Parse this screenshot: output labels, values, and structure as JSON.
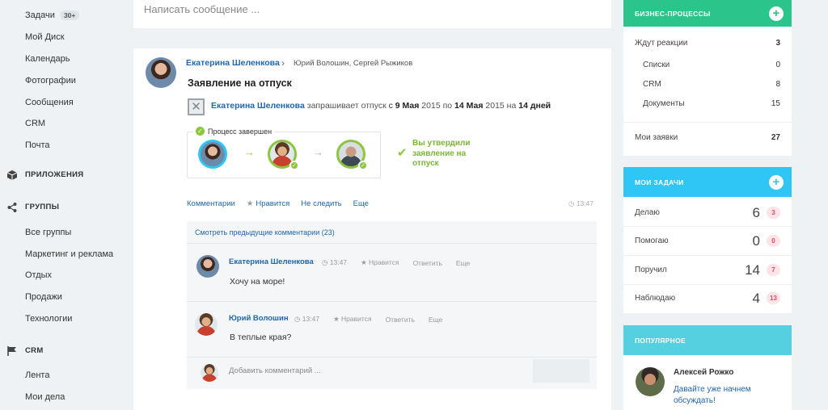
{
  "sidebar": {
    "items_top": [
      {
        "label": "Задачи",
        "badge": "30+"
      },
      {
        "label": "Мой Диск"
      },
      {
        "label": "Календарь"
      },
      {
        "label": "Фотографии"
      },
      {
        "label": "Сообщения"
      },
      {
        "label": "CRM"
      },
      {
        "label": "Почта"
      }
    ],
    "section_apps": "ПРИЛОЖЕНИЯ",
    "section_groups": "ГРУППЫ",
    "groups": [
      "Все группы",
      "Маркетинг и реклама",
      "Отдых",
      "Продажи",
      "Технологии"
    ],
    "section_crm": "CRM",
    "crm_items": [
      "Лента",
      "Мои дела"
    ]
  },
  "composer": {
    "placeholder": "Написать сообщение ..."
  },
  "post": {
    "author": "Екатерина Шеленкова",
    "recipients": "Юрий Волошин, Сергей Рыжиков",
    "title": "Заявление на отпуск",
    "request": {
      "who": "Екатерина Шеленкова",
      "verb": "запрашивает отпуск",
      "from_word": "с",
      "from_date": "9 Мая",
      "from_year": "2015",
      "to_word": "по",
      "to_date": "14 Мая",
      "to_year": "2015",
      "on_word": "на",
      "days": "14 дней"
    },
    "process_label": "Процесс завершен",
    "approved_text": "Вы утвердили заявление на отпуск",
    "actions": {
      "comments": "Комментарии",
      "like": "Нравится",
      "unfollow": "Не следить",
      "more": "Еще",
      "time": "13:47"
    },
    "prev_comments": "Смотреть предыдущие комментарии (23)",
    "comments": [
      {
        "author": "Екатерина Шеленкова",
        "time": "13:47",
        "like": "Нравится",
        "reply": "Ответить",
        "more": "Еще",
        "text": "Хочу на море!"
      },
      {
        "author": "Юрий Волошин",
        "time": "13:47",
        "like": "Нравится",
        "reply": "Ответить",
        "more": "Еще",
        "text": "В теплые края?"
      }
    ],
    "add_comment_placeholder": "Добавить комментарий ..."
  },
  "right": {
    "business": {
      "title": "БИЗНЕС-ПРОЦЕССЫ",
      "color": "#2bc48a",
      "waiting_label": "Ждут реакции",
      "waiting_count": "3",
      "subs": [
        {
          "label": "Списки",
          "count": "0"
        },
        {
          "label": "CRM",
          "count": "8"
        },
        {
          "label": "Документы",
          "count": "15"
        }
      ],
      "mine_label": "Мои заявки",
      "mine_count": "27"
    },
    "tasks": {
      "title": "МОИ ЗАДАЧИ",
      "color": "#2fc6f6",
      "rows": [
        {
          "label": "Делаю",
          "count": "6",
          "new": "3"
        },
        {
          "label": "Помогаю",
          "count": "0",
          "new": "0"
        },
        {
          "label": "Поручил",
          "count": "14",
          "new": "7"
        },
        {
          "label": "Наблюдаю",
          "count": "4",
          "new": "13"
        }
      ]
    },
    "popular": {
      "title": "ПОПУЛЯРНОЕ",
      "color": "#55d0e0",
      "author": "Алексей Рожко",
      "text": "Давайте уже начнем обсуждать!"
    }
  }
}
